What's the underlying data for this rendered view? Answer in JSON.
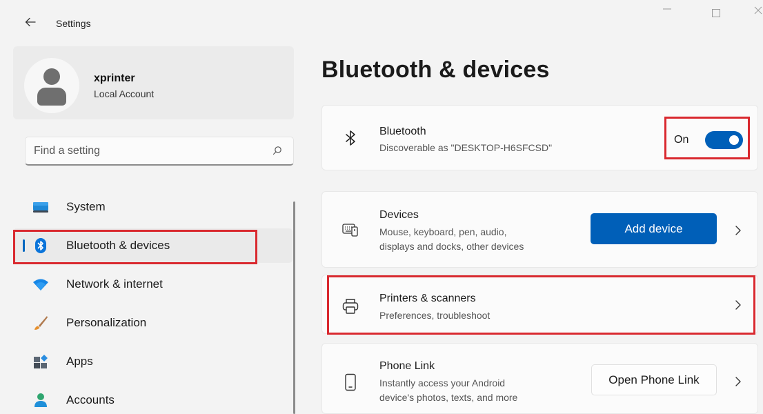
{
  "window": {
    "title": "Settings"
  },
  "profile": {
    "name": "xprinter",
    "account_type": "Local Account"
  },
  "search": {
    "placeholder": "Find a setting"
  },
  "nav": {
    "items": [
      {
        "label": "System",
        "icon": "system-icon"
      },
      {
        "label": "Bluetooth & devices",
        "icon": "bluetooth-icon",
        "selected": true
      },
      {
        "label": "Network & internet",
        "icon": "wifi-icon"
      },
      {
        "label": "Personalization",
        "icon": "brush-icon"
      },
      {
        "label": "Apps",
        "icon": "apps-icon"
      },
      {
        "label": "Accounts",
        "icon": "accounts-icon"
      }
    ]
  },
  "main": {
    "title": "Bluetooth & devices",
    "bluetooth": {
      "title": "Bluetooth",
      "subtitle": "Discoverable as \"DESKTOP-H6SFCSD\"",
      "toggle_label": "On",
      "enabled": true
    },
    "devices": {
      "title": "Devices",
      "subtitle_line1": "Mouse, keyboard, pen, audio,",
      "subtitle_line2": "displays and docks, other devices",
      "button_label": "Add device"
    },
    "printers": {
      "title": "Printers & scanners",
      "subtitle": "Preferences, troubleshoot"
    },
    "phone_link": {
      "title": "Phone Link",
      "subtitle_line1": "Instantly access your Android",
      "subtitle_line2": "device's photos, texts, and more",
      "button_label": "Open Phone Link"
    }
  },
  "colors": {
    "accent": "#005fb8",
    "highlight": "#d9292f",
    "background": "#f3f3f3"
  }
}
